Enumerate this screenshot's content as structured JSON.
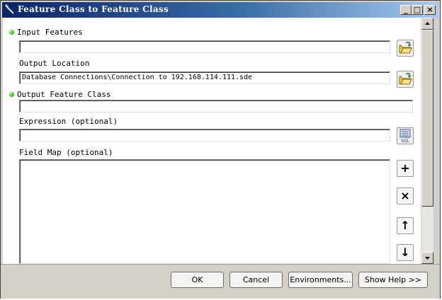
{
  "window": {
    "title": "Feature Class to Feature Class",
    "controls": {
      "minimize": "_",
      "maximize": "□",
      "close": "×"
    }
  },
  "form": {
    "input_features": {
      "label": "Input Features",
      "value": "",
      "required": true
    },
    "output_location": {
      "label": "Output Location",
      "value": "Database Connections\\Connection to 192.168.114.111.sde"
    },
    "output_feature_class": {
      "label": "Output Feature Class",
      "value": "",
      "required": true
    },
    "expression": {
      "label": "Expression (optional)",
      "value": ""
    },
    "field_map": {
      "label": "Field Map (optional)",
      "tools": [
        {
          "name": "add-field-button",
          "glyph": "+"
        },
        {
          "name": "delete-field-button",
          "glyph": "×"
        },
        {
          "name": "move-up-button",
          "glyph": "↑"
        },
        {
          "name": "move-down-button",
          "glyph": "↓"
        }
      ]
    },
    "sql_icon_text": "SQL"
  },
  "buttons": {
    "ok": "OK",
    "cancel": "Cancel",
    "environments": "Environments...",
    "show_help": "Show Help >>"
  },
  "colors": {
    "titlebar_start": "#0a246a",
    "titlebar_end": "#a6caf0",
    "required_dot": "#3ac21a",
    "dialog_face": "#d4d0c8"
  }
}
